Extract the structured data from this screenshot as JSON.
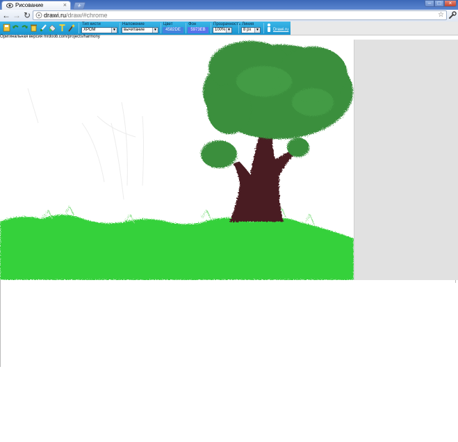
{
  "browser": {
    "tab_title": "Рисование",
    "tab_close": "×",
    "new_tab": "+",
    "url_host": "drawi.ru",
    "url_path": "/draw/#chrome",
    "window_controls": {
      "minimize": "–",
      "maximize": "□",
      "close": "×"
    }
  },
  "nav": {
    "back": "←",
    "forward": "→",
    "reload": "↻",
    "star": "☆",
    "wrench": "🔧"
  },
  "app": {
    "brush_type_label": "Тип кисти",
    "brush_type_value": "ХРОМ",
    "blending_label": "Наложение",
    "blending_value": "вычитание",
    "color_label": "Цвет",
    "color_value": "4582DE",
    "background_label": "Фон",
    "background_value": "5973EB",
    "opacity_label": "Прозрачность",
    "opacity_value": "100%",
    "line_label": "Линия",
    "line_value": "8 px",
    "brand_link": "Drawi.ru",
    "select_arrow": "▼"
  },
  "credit_text": "Оригинальная версия mrdoob.com/projects/harmony",
  "colors": {
    "accent": "#1a93cf",
    "grass": "#35d13a",
    "foliage": "#3a8f3c",
    "trunk": "#4a1e22",
    "color_swatch": "#4582de",
    "background_swatch": "#5973eb"
  },
  "tools": [
    "save-icon",
    "undo-icon",
    "redo-icon",
    "trash-icon",
    "brush-icon",
    "fill-icon",
    "text-icon",
    "magic-wand-icon"
  ]
}
